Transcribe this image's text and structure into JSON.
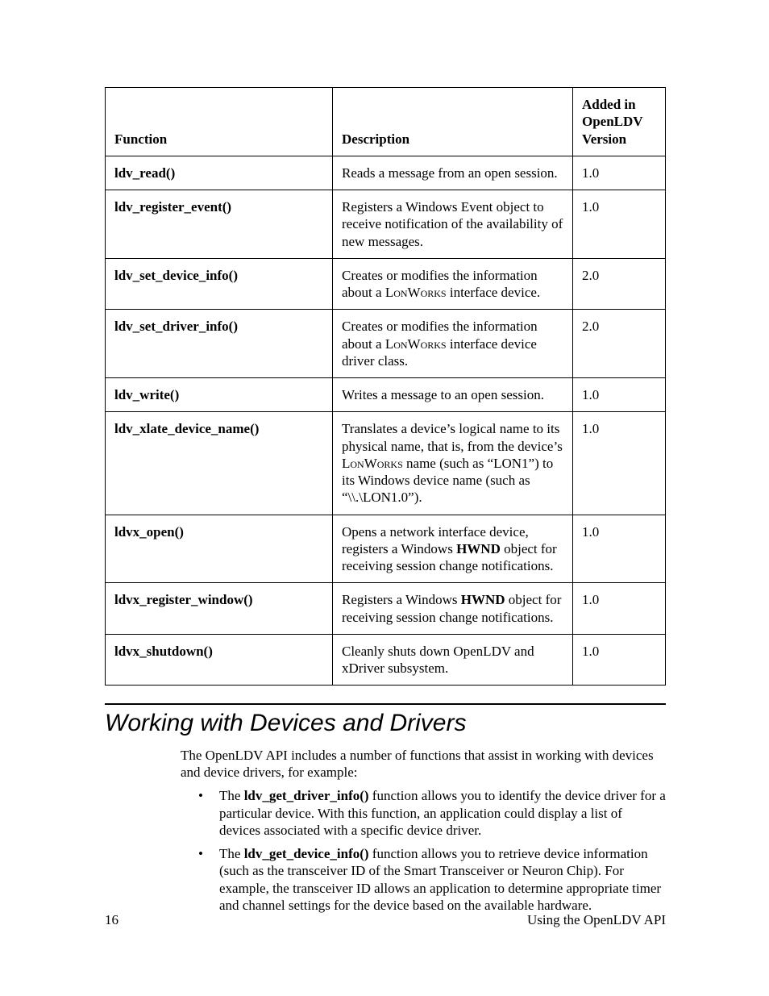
{
  "table": {
    "headers": {
      "func": "Function",
      "desc": "Description",
      "ver": "Added in OpenLDV Version"
    },
    "rows": [
      {
        "fn": "ldv_read()",
        "desc_plain": "Reads a message from an open session.",
        "ver": "1.0"
      },
      {
        "fn": "ldv_register_event()",
        "desc_plain": "Registers a Windows Event object to receive notification of the availability of new messages.",
        "ver": "1.0"
      },
      {
        "fn": "ldv_set_device_info()",
        "desc_pre": "Creates or modifies the information about a ",
        "desc_sc": "LonWorks",
        "desc_post": " interface device.",
        "ver": "2.0"
      },
      {
        "fn": "ldv_set_driver_info()",
        "desc_pre": "Creates or modifies the information about a ",
        "desc_sc": "LonWorks",
        "desc_post": " interface device driver class.",
        "ver": "2.0"
      },
      {
        "fn": "ldv_write()",
        "desc_plain": "Writes a message to an open session.",
        "ver": "1.0"
      },
      {
        "fn": "ldv_xlate_device_name()",
        "desc_pre": "Translates a device’s logical name to its physical name, that is, from the device’s ",
        "desc_sc": "LonWorks",
        "desc_post": " name (such as “LON1”) to its Windows device name (such as “\\\\.\\LON1.0”).",
        "ver": "1.0"
      },
      {
        "fn": "ldvx_open()",
        "desc_hwnd_pre": "Opens a network interface device, registers a Windows ",
        "desc_hwnd": "HWND",
        "desc_hwnd_post": " object for receiving session change notifications.",
        "ver": "1.0"
      },
      {
        "fn": "ldvx_register_window()",
        "desc_hwnd_pre": "Registers a Windows ",
        "desc_hwnd": "HWND",
        "desc_hwnd_post": " object for receiving session change notifications.",
        "ver": "1.0"
      },
      {
        "fn": "ldvx_shutdown()",
        "desc_plain": "Cleanly shuts down OpenLDV and xDriver subsystem.",
        "ver": "1.0"
      }
    ]
  },
  "section": {
    "title": "Working with Devices and Drivers",
    "intro": "The OpenLDV API includes a number of functions that assist in working with devices and device drivers, for example:",
    "bullets": [
      {
        "pre": "The ",
        "fn": "ldv_get_driver_info()",
        "post": " function allows you to identify the device driver for a particular device.  With this function, an application could display a list of devices associated with a specific device driver."
      },
      {
        "pre": "The ",
        "fn": "ldv_get_device_info()",
        "post": " function allows you to retrieve device information (such as the transceiver ID of the Smart Transceiver or Neuron Chip).  For example, the transceiver ID allows an application to determine appropriate timer and channel settings for the device based on the available hardware."
      }
    ]
  },
  "footer": {
    "page": "16",
    "doc": "Using the OpenLDV API"
  }
}
